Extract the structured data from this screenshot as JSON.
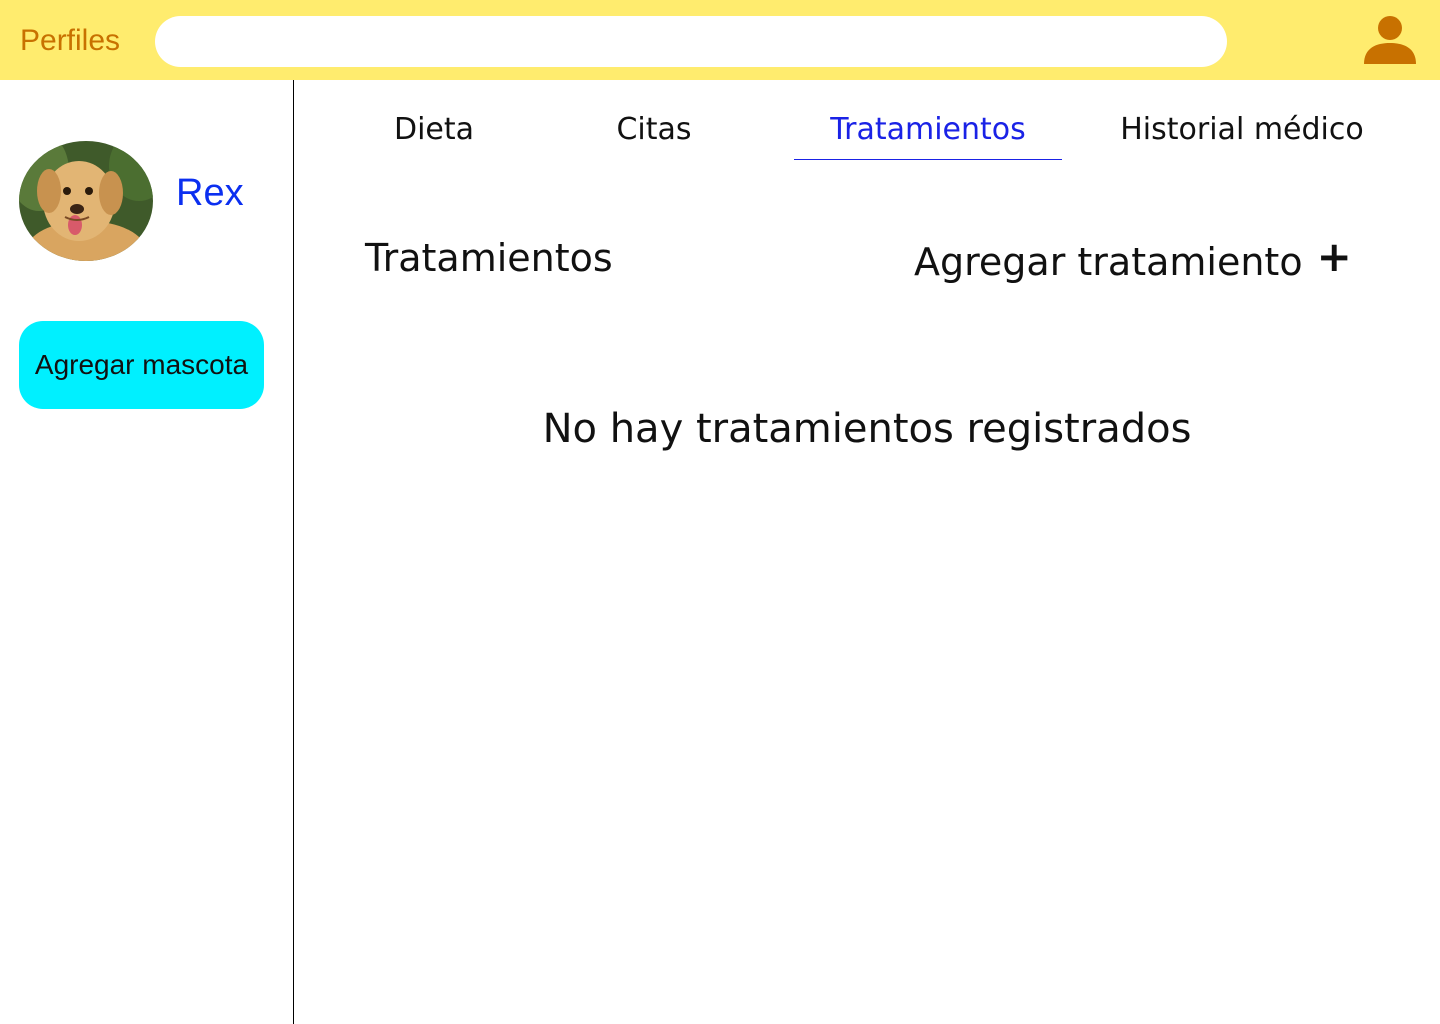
{
  "header": {
    "title": "Perfiles",
    "search_placeholder": "",
    "search_value": "",
    "user_icon": "user-icon",
    "background_color": "#ffec6e",
    "title_color": "#c87100"
  },
  "sidebar": {
    "pet": {
      "name": "Rex",
      "avatar": "dog-photo",
      "name_color": "#0b2ff0"
    },
    "add_pet_label": "Agregar mascota",
    "add_pet_color": "#00f0ff"
  },
  "tabs": [
    {
      "label": "Dieta",
      "active": false
    },
    {
      "label": "Citas",
      "active": false
    },
    {
      "label": "Tratamientos",
      "active": true
    },
    {
      "label": "Historial médico",
      "active": false
    }
  ],
  "main": {
    "section_title": "Tratamientos",
    "add_label": "Agregar tratamiento",
    "add_icon": "plus-icon",
    "empty_message": "No hay tratamientos registrados",
    "active_tab_color": "#1a22e6"
  }
}
